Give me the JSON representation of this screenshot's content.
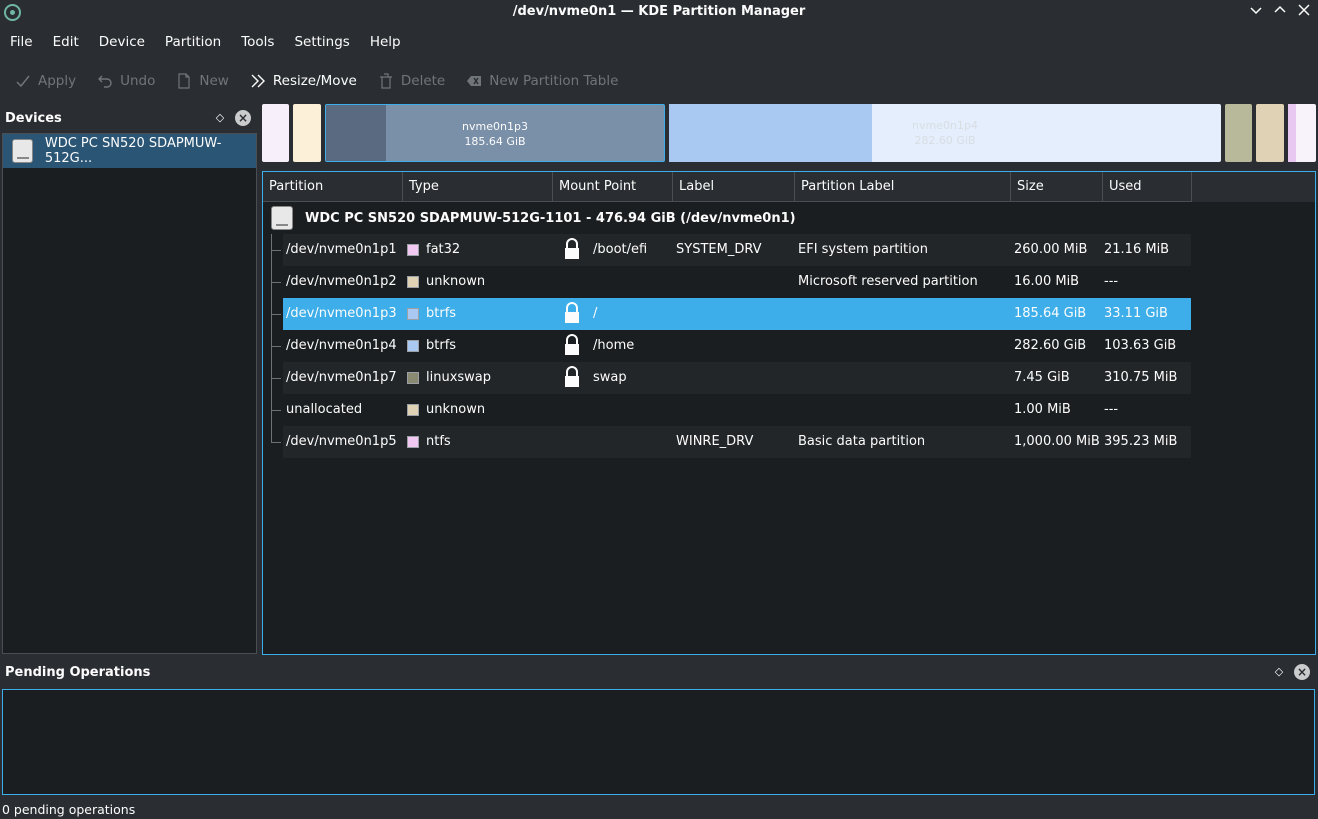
{
  "window": {
    "title": "/dev/nvme0n1 — KDE Partition Manager",
    "controls": [
      "minimize",
      "maximize",
      "close"
    ]
  },
  "menu": [
    "File",
    "Edit",
    "Device",
    "Partition",
    "Tools",
    "Settings",
    "Help"
  ],
  "toolbar": {
    "apply": "Apply",
    "undo": "Undo",
    "new": "New",
    "resize_move": "Resize/Move",
    "delete": "Delete",
    "new_partition_table": "New Partition Table"
  },
  "devices_panel": {
    "title": "Devices",
    "items": [
      {
        "label": "WDC PC SN520 SDAPMUW-512G...",
        "icon": "disk-icon"
      }
    ]
  },
  "partition_bar": {
    "segments": [
      {
        "name": "",
        "size": "",
        "fill": "#f7f0fa",
        "used_fill": "#f7f0fa",
        "used_ratio": 0
      },
      {
        "name": "",
        "size": "",
        "fill": "#fdf0d8",
        "used_fill": "#fdf0d8",
        "used_ratio": 0
      },
      {
        "name": "nvme0n1p3",
        "size": "185.64 GiB",
        "fill": "#7a8fa8",
        "used_fill": "#5a6a80",
        "used_ratio": 0.178
      },
      {
        "name": "nvme0n1p4",
        "size": "282.60 GiB",
        "fill": "#e4eefc",
        "used_fill": "#a9c8f2",
        "used_ratio": 0.367
      },
      {
        "name": "",
        "size": "",
        "fill": "#b8b89a",
        "used_fill": "#b8b89a",
        "used_ratio": 0
      },
      {
        "name": "",
        "size": "",
        "fill": "#e0d2b4",
        "used_fill": "#e0d2b4",
        "used_ratio": 0
      },
      {
        "name": "",
        "size": "",
        "fill": "#f8f2fb",
        "used_fill": "#e8c8f0",
        "used_ratio": 0.3
      }
    ]
  },
  "tree": {
    "columns": [
      "Partition",
      "Type",
      "Mount Point",
      "Label",
      "Partition Label",
      "Size",
      "Used"
    ],
    "device_label": "WDC PC SN520 SDAPMUW-512G-1101 - 476.94 GiB (/dev/nvme0n1)",
    "rows": [
      {
        "partition": "/dev/nvme0n1p1",
        "type": "fat32",
        "color": "#f1c8f1",
        "locked": true,
        "mount": "/boot/efi",
        "label": "SYSTEM_DRV",
        "partition_label": "EFI system partition",
        "size": "260.00 MiB",
        "used": "21.16 MiB",
        "selected": false
      },
      {
        "partition": "/dev/nvme0n1p2",
        "type": "unknown",
        "color": "#e0d2b4",
        "locked": false,
        "mount": "",
        "label": "",
        "partition_label": "Microsoft reserved partition",
        "size": "16.00 MiB",
        "used": "---",
        "selected": false
      },
      {
        "partition": "/dev/nvme0n1p3",
        "type": "btrfs",
        "color": "#a9c8f2",
        "locked": true,
        "mount": "/",
        "label": "",
        "partition_label": "",
        "size": "185.64 GiB",
        "used": "33.11 GiB",
        "selected": true
      },
      {
        "partition": "/dev/nvme0n1p4",
        "type": "btrfs",
        "color": "#a9c8f2",
        "locked": true,
        "mount": "/home",
        "label": "",
        "partition_label": "",
        "size": "282.60 GiB",
        "used": "103.63 GiB",
        "selected": false
      },
      {
        "partition": "/dev/nvme0n1p7",
        "type": "linuxswap",
        "color": "#8a8a72",
        "locked": true,
        "mount": "swap",
        "label": "",
        "partition_label": "",
        "size": "7.45 GiB",
        "used": "310.75 MiB",
        "selected": false
      },
      {
        "partition": "unallocated",
        "type": "unknown",
        "color": "#e0d2b4",
        "locked": false,
        "mount": "",
        "label": "",
        "partition_label": "",
        "size": "1.00 MiB",
        "used": "---",
        "selected": false
      },
      {
        "partition": "/dev/nvme0n1p5",
        "type": "ntfs",
        "color": "#f1c8f1",
        "locked": false,
        "mount": "",
        "label": "WINRE_DRV",
        "partition_label": "Basic data partition",
        "size": "1,000.00 MiB",
        "used": "395.23 MiB",
        "selected": false
      }
    ]
  },
  "pending_panel": {
    "title": "Pending Operations"
  },
  "status": "0 pending operations",
  "colors": {
    "accent": "#3daee9",
    "window_bg": "#2a2e32",
    "view_bg": "#1b1e20"
  }
}
